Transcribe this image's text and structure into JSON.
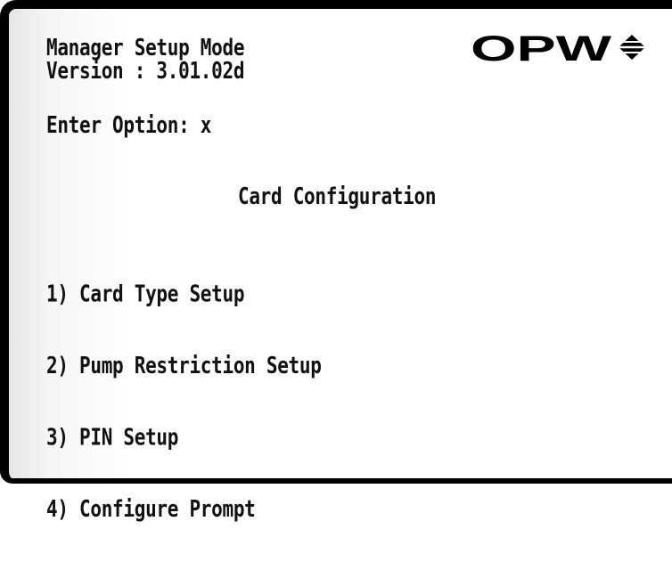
{
  "header": {
    "title": "Manager Setup Mode",
    "version": "Version : 3.01.02d"
  },
  "logo": {
    "text": "OPW",
    "mark_icon": "diamond-stripes-icon"
  },
  "prompt": {
    "label": "Enter Option: x"
  },
  "menu": {
    "title": "Card Configuration",
    "items": [
      {
        "label": "1) Card Type Setup"
      },
      {
        "label": "2) Pump Restriction Setup"
      },
      {
        "label": "3) PIN Setup"
      },
      {
        "label": "4) Configure Prompt"
      }
    ]
  }
}
